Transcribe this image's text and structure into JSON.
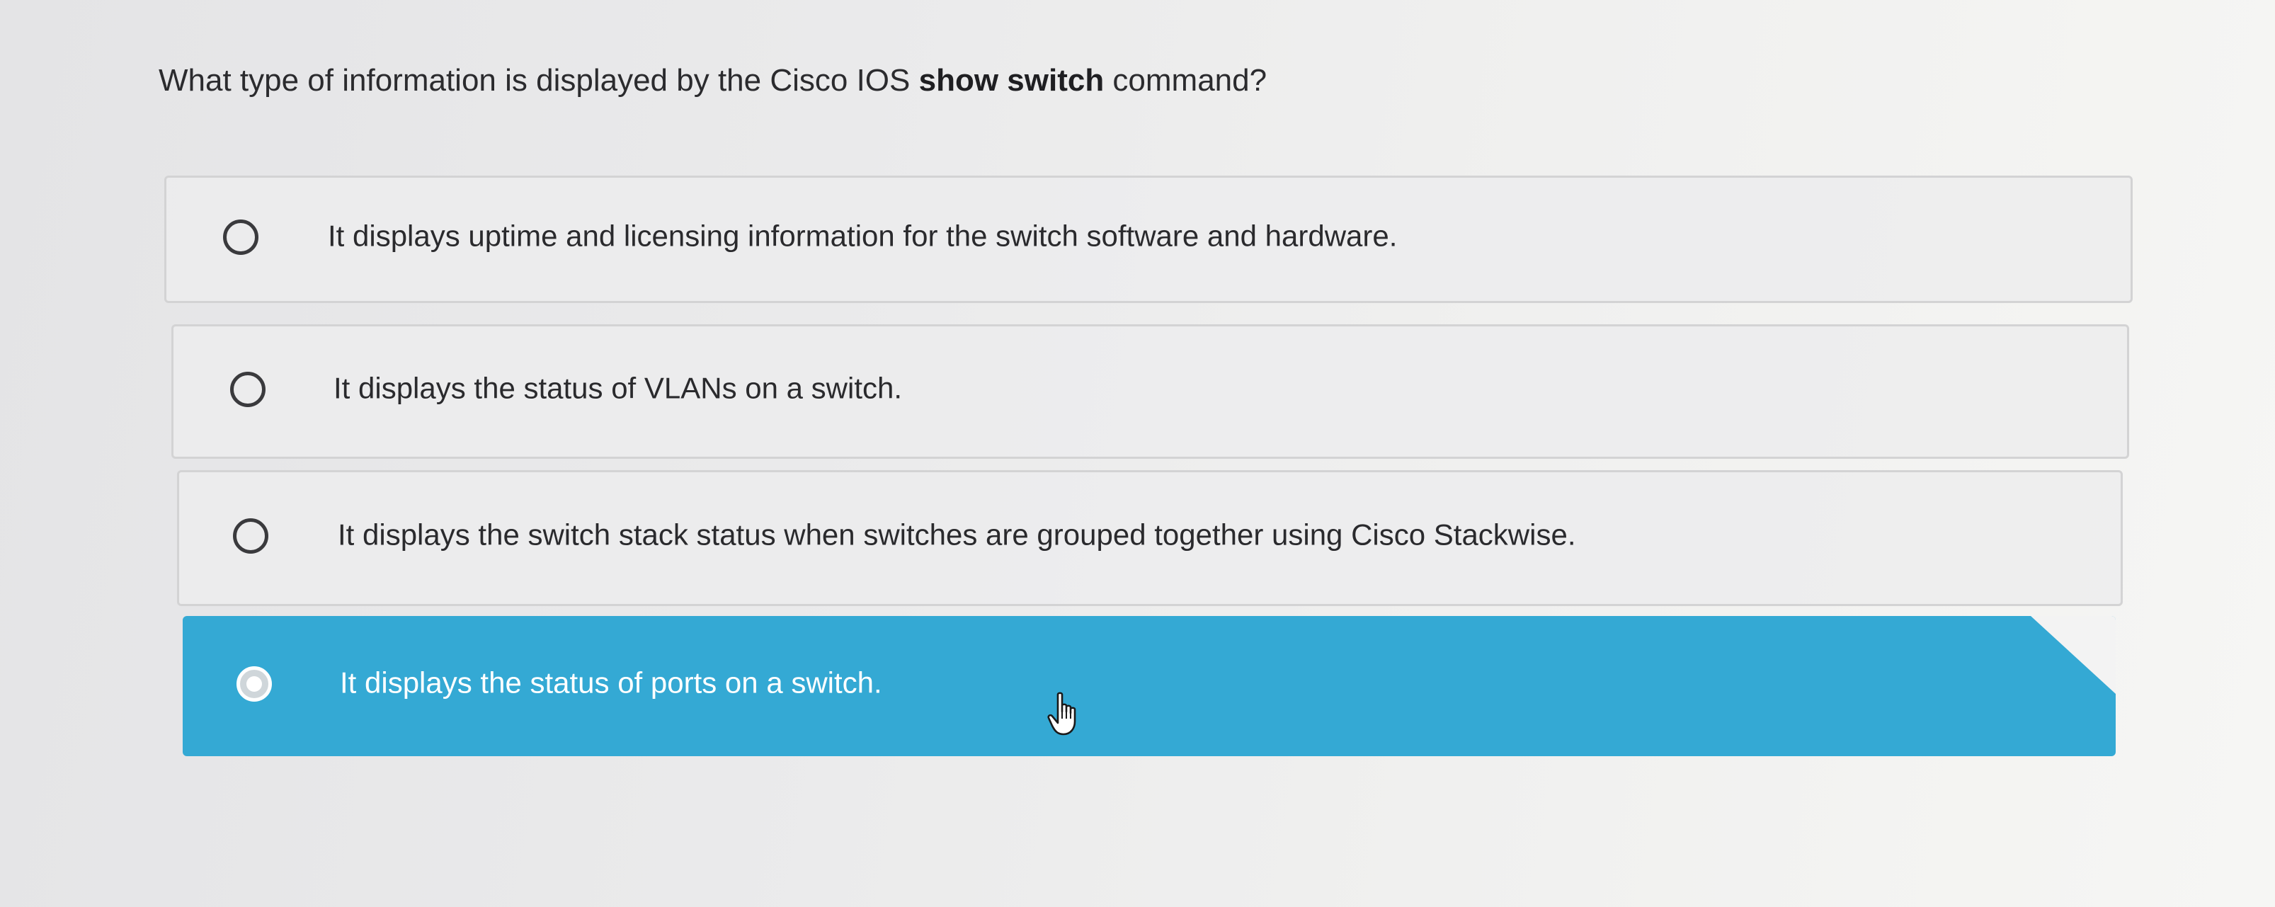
{
  "question": {
    "prefix": "What type of information is displayed by the Cisco IOS ",
    "command": "show switch",
    "suffix": " command?"
  },
  "options": [
    {
      "label": "It displays uptime and licensing information for the switch software and hardware.",
      "selected": false
    },
    {
      "label": "It displays the status of VLANs on a switch.",
      "selected": false
    },
    {
      "label": "It displays the switch stack status when switches are grouped together using Cisco Stackwise.",
      "selected": false
    },
    {
      "label": "It displays the status of ports on a switch.",
      "selected": true
    }
  ],
  "colors": {
    "selected_background": "#34a9d4",
    "selected_text": "#ffffff",
    "option_background": "#ececed"
  },
  "icons": {
    "unselected_option": "radio-unchecked-icon",
    "selected_option": "radio-checked-icon",
    "pointer": "hand-pointer-icon"
  }
}
